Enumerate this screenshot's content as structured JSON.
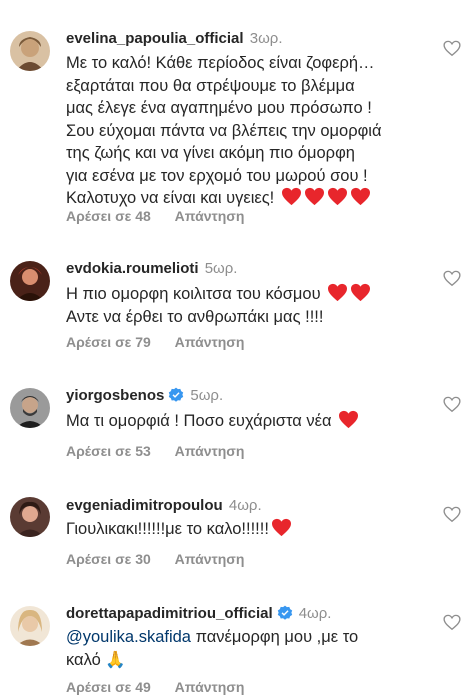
{
  "comments": [
    {
      "username": "evelina_papoulia_official",
      "time": "3ωρ.",
      "verified": false,
      "lines": [
        "Με το καλό! Κάθε περίοδος είναι ζοφερή…",
        "εξαρτάται που θα στρέψουμε  το βλέμμα",
        "μας έλεγε ένα αγαπημένο μου πρόσωπο !",
        "Σου εύχομαι πάντα να βλέπεις την ομορφιά",
        "της ζωής και να  γίνει ακόμη πιο όμορφη",
        "για εσένα  με τον ερχομό  του μωρού σου !",
        "Καλοτυχο να είναι και υγειες!"
      ],
      "hearts": 4,
      "likes": "Αρέσει σε 48",
      "reply": "Απάντηση",
      "avatar_colors": [
        "#c9a27a",
        "#6b4a32"
      ]
    },
    {
      "username": "evdokia.roumelioti",
      "time": "5ωρ.",
      "verified": false,
      "lines": [
        "Η πιο ομορφη κοιλιτσα του κόσμου",
        "Αντε να έρθει το ανθρωπάκι μας !!!!"
      ],
      "hearts": 2,
      "likes": "Αρέσει σε 79",
      "reply": "Απάντηση",
      "avatar_colors": [
        "#b23a2a",
        "#3a1a12"
      ]
    },
    {
      "username": "yiorgosbenos",
      "time": "5ωρ.",
      "verified": true,
      "lines": [
        "Μα τι ομορφιά ! Ποσο ευχάριστα νέα"
      ],
      "hearts": 1,
      "likes": "Αρέσει σε 53",
      "reply": "Απάντηση",
      "avatar_colors": [
        "#8d8d8d",
        "#2e2e2e"
      ]
    },
    {
      "username": "evgeniadimitropoulou",
      "time": "4ωρ.",
      "verified": false,
      "lines": [
        "Γιουλικακι!!!!!!με το καλο!!!!!!"
      ],
      "hearts": 1,
      "likes": "Αρέσει σε 30",
      "reply": "Απάντηση",
      "avatar_colors": [
        "#c58b7a",
        "#3b2420"
      ]
    },
    {
      "username": "dorettapapadimitriou_official",
      "time": "4ωρ.",
      "verified": true,
      "mention": "@youlika.skafida",
      "lines": [
        " πανέμορφη μου ,με το",
        "καλό 🙏"
      ],
      "hearts": 0,
      "likes": "Αρέσει σε 49",
      "reply": "Απάντηση",
      "avatar_colors": [
        "#e9d6b8",
        "#a07850"
      ]
    }
  ],
  "colors": {
    "heart": "#e8262c",
    "verified": "#3897f0",
    "secondary_text": "#8e8e8e",
    "mention": "#00376b"
  }
}
